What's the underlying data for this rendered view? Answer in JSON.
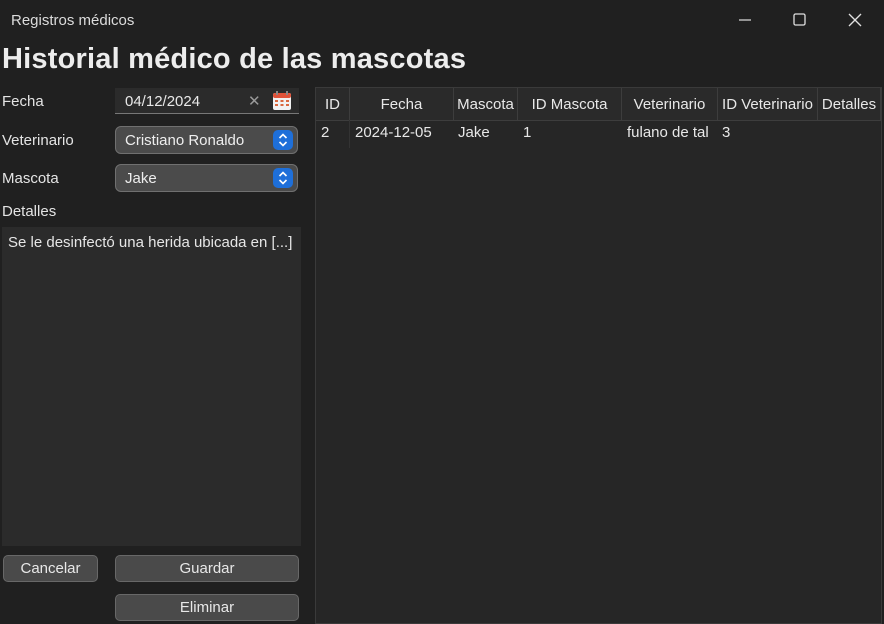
{
  "window": {
    "title": "Registros médicos"
  },
  "heading": "Historial médico de las mascotas",
  "form": {
    "fecha_label": "Fecha",
    "fecha_value": "04/12/2024",
    "veterinario_label": "Veterinario",
    "veterinario_value": "Cristiano Ronaldo",
    "mascota_label": "Mascota",
    "mascota_value": "Jake",
    "detalles_label": "Detalles",
    "detalles_value": "Se le desinfectó una herida ubicada en [...]"
  },
  "buttons": {
    "cancelar": "Cancelar",
    "guardar": "Guardar",
    "eliminar": "Eliminar"
  },
  "table": {
    "columns": [
      "ID",
      "Fecha",
      "Mascota",
      "ID Mascota",
      "Veterinario",
      "ID Veterinario",
      "Detalles"
    ],
    "rows": [
      [
        "2",
        "2024-12-05",
        "Jake",
        "1",
        "fulano de tal",
        "3",
        ""
      ]
    ]
  },
  "colors": {
    "accent": "#1e6fd9",
    "background": "#202020",
    "field": "#2b2b2b"
  }
}
